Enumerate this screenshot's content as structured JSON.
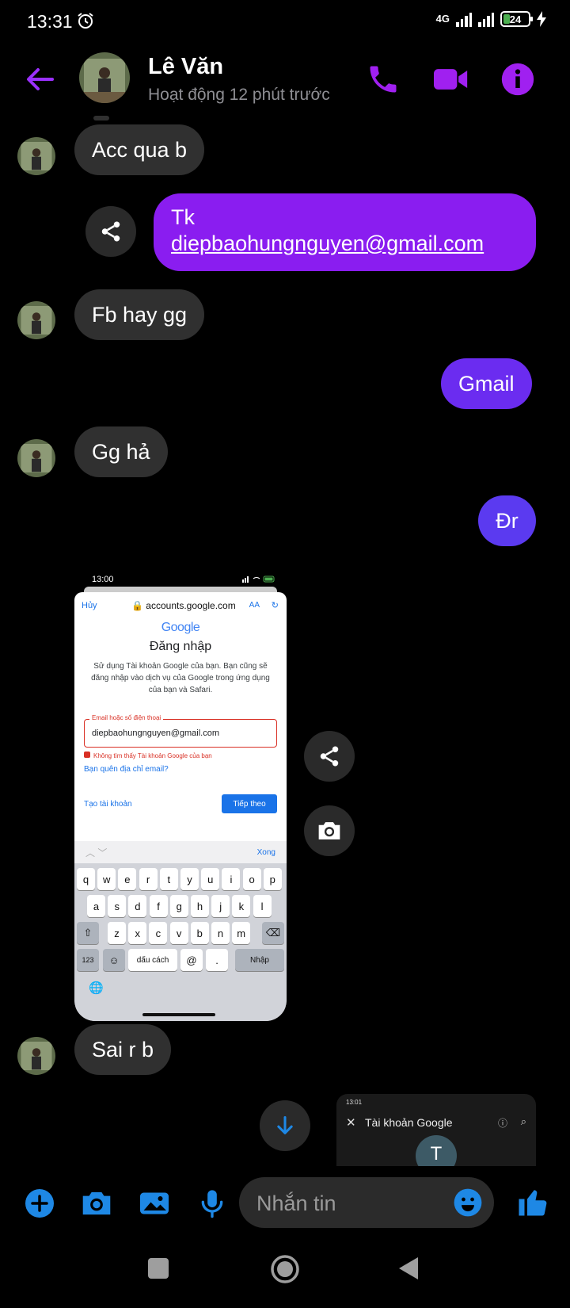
{
  "status_bar": {
    "time": "13:31",
    "network": "4G",
    "battery": "24"
  },
  "header": {
    "name": "Lê Văn",
    "status": "Hoạt động 12 phút trước"
  },
  "messages": [
    {
      "side": "in",
      "text": "Acc qua b"
    },
    {
      "side": "out",
      "line1": "Tk",
      "link": "diepbaohungnguyen@gmail.com"
    },
    {
      "side": "in",
      "text": "Fb hay gg"
    },
    {
      "side": "out",
      "text": "Gmail"
    },
    {
      "side": "in",
      "text": "Gg hả"
    },
    {
      "side": "out",
      "text": "Đr"
    },
    {
      "side": "in",
      "text": "Sai r b"
    }
  ],
  "screenshot": {
    "time": "13:00",
    "cancel": "Hủy",
    "url": "accounts.google.com",
    "text_size": "AA",
    "logo": "Google",
    "title": "Đăng nhập",
    "description": "Sử dụng Tài khoản Google của bạn. Bạn cũng sẽ đăng nhập vào dịch vụ của Google trong ứng dụng của bạn và Safari.",
    "email_label": "Email hoặc số điện thoại",
    "email_value": "diepbaohungnguyen@gmail.com",
    "error": "Không tìm thấy Tài khoản Google của bạn",
    "forgot": "Bạn quên địa chỉ email?",
    "create": "Tạo tài khoản",
    "next": "Tiếp theo",
    "done": "Xong",
    "keyboard_row1": [
      "q",
      "w",
      "e",
      "r",
      "t",
      "y",
      "u",
      "i",
      "o",
      "p"
    ],
    "keyboard_row2": [
      "a",
      "s",
      "d",
      "f",
      "g",
      "h",
      "j",
      "k",
      "l"
    ],
    "keyboard_row3": [
      "z",
      "x",
      "c",
      "v",
      "b",
      "n",
      "m"
    ],
    "key_123": "123",
    "key_space": "dấu cách",
    "key_at": "@",
    "key_dot": ".",
    "key_return": "Nhập"
  },
  "preview_card": {
    "time": "13:01",
    "title": "Tài khoản Google",
    "avatar_letter": "T"
  },
  "composer": {
    "placeholder": "Nhắn tin"
  },
  "colors": {
    "accent": "#8a2be2",
    "icon_blue": "#1e88e5",
    "incoming_bubble": "#303030"
  }
}
